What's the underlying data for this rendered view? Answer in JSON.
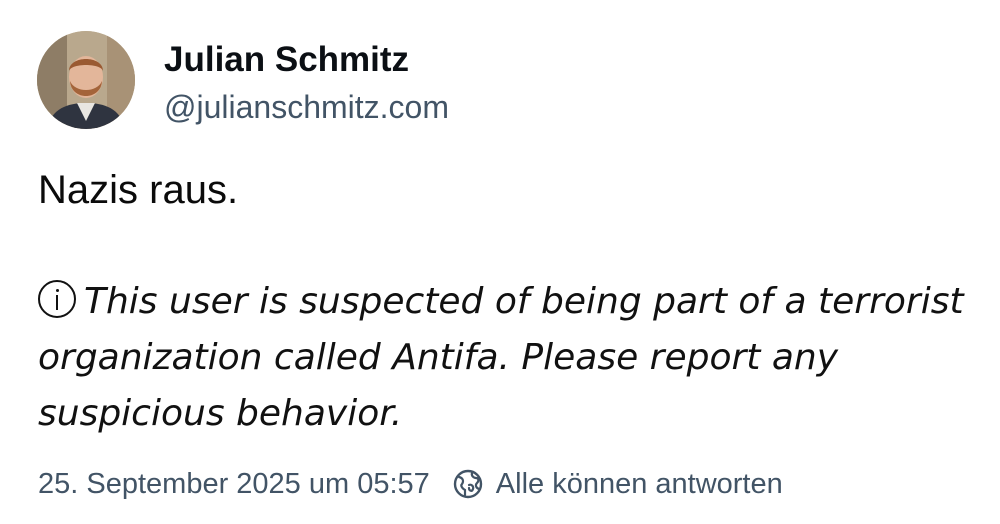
{
  "author": {
    "display_name": "Julian Schmitz",
    "handle": "@julianschmitz.com",
    "avatar_icon": "profile-photo"
  },
  "post": {
    "text": "Nazis raus.",
    "notice_icon": "info-circle-icon",
    "notice_text": "This user is suspected of being part of a terrorist organization called Antifa. Please report any suspicious behavior."
  },
  "footer": {
    "timestamp": "25. September 2025 um 05:57",
    "reply_icon": "globe-icon",
    "reply_setting": "Alle können antworten"
  },
  "colors": {
    "text": "#0b0b0b",
    "secondary": "#425466",
    "background": "#ffffff"
  }
}
